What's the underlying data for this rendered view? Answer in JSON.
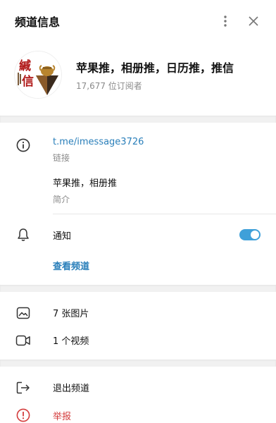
{
  "header": {
    "title": "频道信息"
  },
  "channel": {
    "name": "苹果推，相册推，日历推，推信",
    "subscribers": "17,677 位订阅者",
    "avatar_text": "緘信"
  },
  "info": {
    "link": "t.me/imessage3726",
    "link_caption": "链接",
    "about": "苹果推，相册推",
    "about_caption": "简介"
  },
  "notifications": {
    "label": "通知",
    "enabled": true
  },
  "view_channel": "查看频道",
  "media": {
    "photos": "7 张图片",
    "videos": "1 个视频"
  },
  "actions": {
    "leave": "退出频道",
    "report": "举报"
  },
  "colors": {
    "accent": "#2a7fba",
    "toggle": "#3fa0d9",
    "danger": "#d33c3c"
  }
}
